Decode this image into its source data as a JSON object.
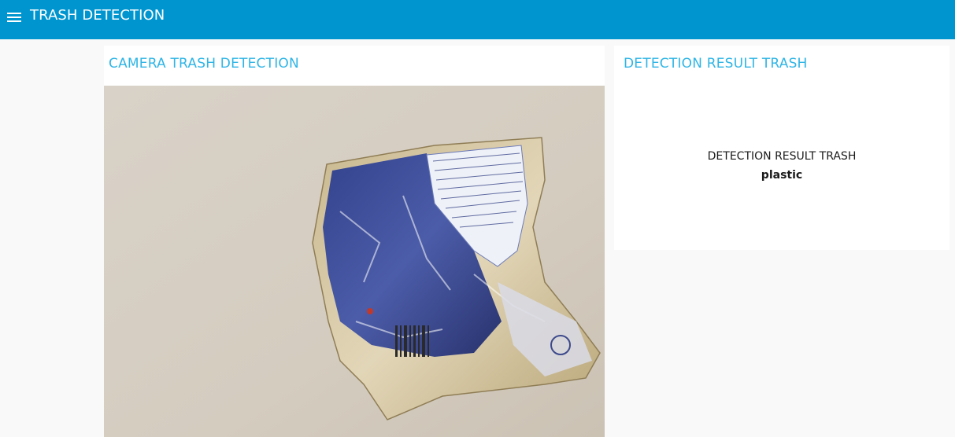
{
  "header": {
    "title": "TRASH DETECTION",
    "menu_icon": "hamburger-menu-icon",
    "background_color": "#0095cf"
  },
  "camera_card": {
    "title": "CAMERA TRASH DETECTION",
    "title_color": "#2fb5e6",
    "image_subject": "photo-crumpled-plastic-snack-wrapper"
  },
  "result_card": {
    "title": "DETECTION RESULT TRASH",
    "result_label": "DETECTION RESULT TRASH",
    "result_value": "plastic"
  }
}
